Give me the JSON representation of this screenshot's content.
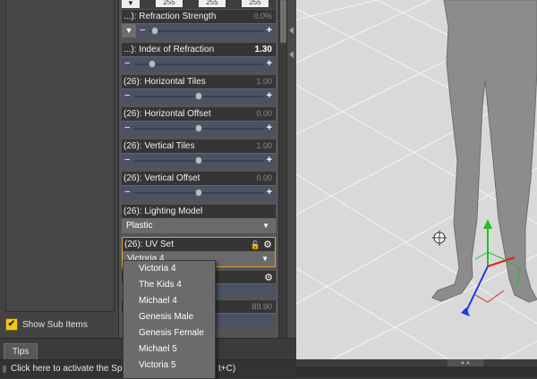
{
  "left_panel": {
    "show_sub_items_label": "Show Sub Items",
    "show_sub_items_checked": true
  },
  "color_row": {
    "values": [
      "255",
      "255",
      "255"
    ]
  },
  "properties": [
    {
      "label": "...): Refraction Strength",
      "value": "0.0%",
      "control": "slider-dropdown",
      "position": 0.0
    },
    {
      "label": "...): Index of Refraction",
      "value": "1.30",
      "control": "slider",
      "position": 0.0,
      "highlight": true
    },
    {
      "label": "(26): Horizontal Tiles",
      "value": "1.00",
      "control": "slider",
      "position": 0.5
    },
    {
      "label": "(26): Horizontal Offset",
      "value": "0.00",
      "control": "slider",
      "position": 0.5
    },
    {
      "label": "(26): Vertical Tiles",
      "value": "1.00",
      "control": "slider",
      "position": 0.5
    },
    {
      "label": "(26): Vertical Offset",
      "value": "0.00",
      "control": "slider",
      "position": 0.5
    },
    {
      "label": "(26): Lighting Model",
      "value": "Plastic",
      "control": "dropdown"
    },
    {
      "label": "(26): UV Set",
      "value": "Victoria 4",
      "control": "dropdown",
      "selected": true
    }
  ],
  "hidden_row_value": "89.90",
  "uv_menu": {
    "options": [
      "Victoria 4",
      "The Kids 4",
      "Michael 4",
      "Genesis Male",
      "Genesis Female",
      "Michael 5",
      "Victoria 5"
    ]
  },
  "tips": {
    "tab_label": "Tips",
    "status_text": "Click here to activate the Sp",
    "status_tail": "t+C)"
  },
  "colors": {
    "accent": "#e0a52a",
    "checkbox": "#f3c620",
    "slider_bg": "#4a5263"
  }
}
